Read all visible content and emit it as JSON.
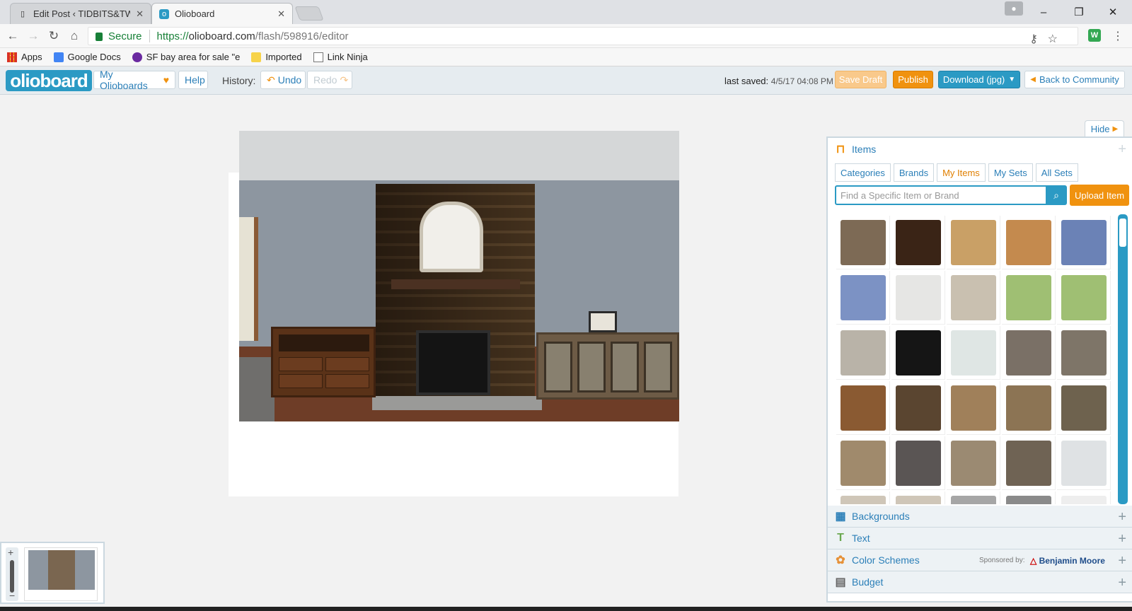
{
  "browser": {
    "tabs": [
      {
        "title": "Edit Post ‹ TIDBITS&TWI",
        "active": false
      },
      {
        "title": "Olioboard",
        "active": true
      }
    ],
    "url_secure_label": "Secure",
    "url_scheme": "https://",
    "url_host": "olioboard.com",
    "url_path": "/flash/598916/editor",
    "bookmarks": [
      "Apps",
      "Google Docs",
      "SF bay area for sale \"e",
      "Imported",
      "Link Ninja"
    ]
  },
  "header": {
    "logo": "olioboard",
    "my_olioboards": "My Olioboards",
    "help": "Help",
    "history_label": "History:",
    "undo": "Undo",
    "redo": "Redo",
    "last_saved_label": "last saved:",
    "last_saved_value": "4/5/17 04:08 PM",
    "save_draft": "Save Draft",
    "publish": "Publish",
    "download": "Download (jpg)",
    "back": "Back to Community"
  },
  "panel": {
    "hide": "Hide",
    "items_title": "Items",
    "tabs": [
      "Categories",
      "Brands",
      "My Items",
      "My Sets",
      "All Sets"
    ],
    "active_tab": "My Items",
    "search_placeholder": "Find a Specific Item or Brand",
    "upload": "Upload Item",
    "sections": [
      "Backgrounds",
      "Text",
      "Color Schemes",
      "Budget"
    ],
    "sponsored_label": "Sponsored by:",
    "sponsor": "Benjamin Moore"
  },
  "colors": {
    "brand_blue": "#2b9ac4",
    "orange": "#f0920f",
    "link": "#2b7fb8"
  }
}
